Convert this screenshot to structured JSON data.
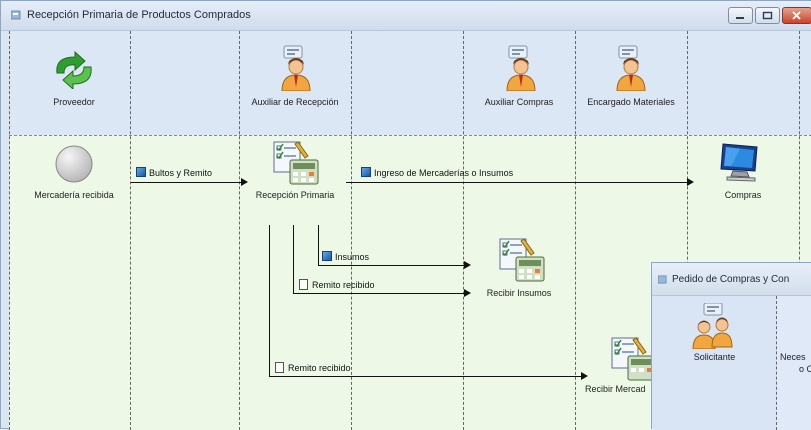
{
  "window": {
    "title": "Recepción Primaria de Productos Comprados"
  },
  "lanes": {
    "proveedor": "Proveedor",
    "auxiliar_recepcion": "Auxiliar de Recepción",
    "auxiliar_compras": "Auxiliar Compras",
    "encargado_materiales": "Encargado Materiales"
  },
  "nodes": {
    "mercaderia_recibida": "Mercadería recibida",
    "recepcion_primaria": "Recepción Primaria",
    "recibir_insumos": "Recibir Insumos",
    "compras": "Compras",
    "recibir_mercad": "Recibir Mercad"
  },
  "edges": {
    "bultos_remito": "Bultos y Remito",
    "ingreso": "Ingreso de Mercaderías o Insumos",
    "insumos": "Insumos",
    "remito_recibido_1": "Remito recibido",
    "remito_recibido_2": "Remito recibido"
  },
  "subwindow": {
    "title": "Pedido de Compras y Con",
    "lane": "Solicitante",
    "partial_line1": "Neces",
    "partial_line2": "o C"
  },
  "colors": {
    "header_band": "#dce7f5",
    "lane_body": "#edf8e6",
    "close_button": "#c8452c"
  }
}
